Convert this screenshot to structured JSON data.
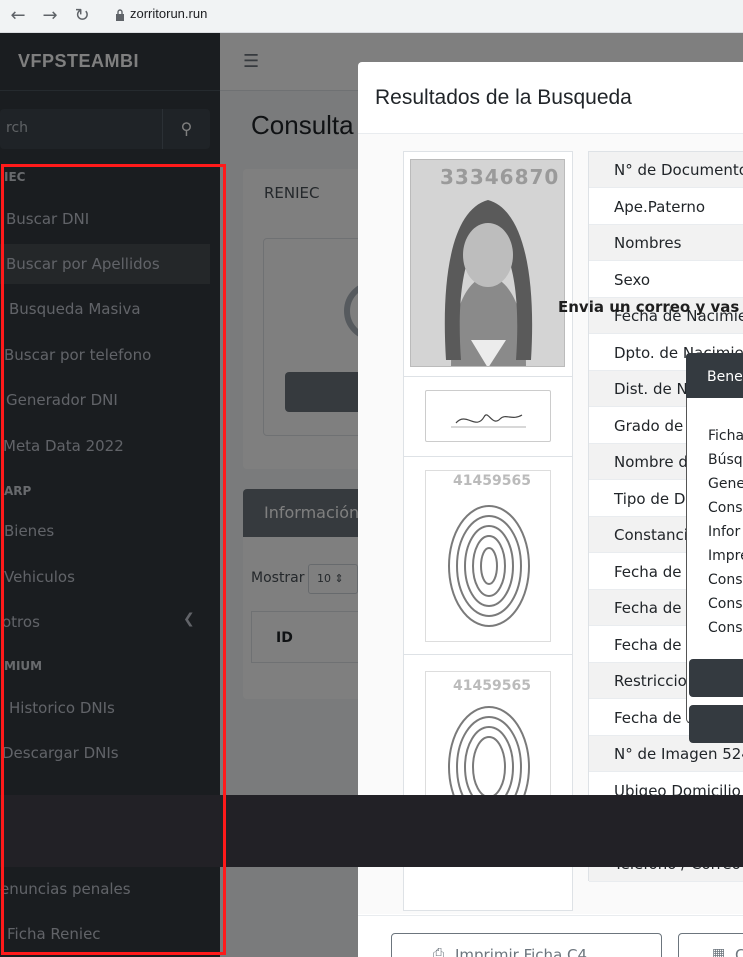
{
  "browser": {
    "url": "zorritorun.run",
    "back_icon": "arrow-left-icon",
    "forward_icon": "arrow-right-icon",
    "reload_icon": "reload-icon"
  },
  "sidebar": {
    "brand": "VFPSTEAMBI",
    "search_placeholder": "rch",
    "sections": [
      {
        "header": "IEC"
      },
      {
        "header": "ARP"
      },
      {
        "header": "MIUM"
      }
    ],
    "items": [
      {
        "label": "Buscar DNI"
      },
      {
        "label": "Buscar por Apellidos"
      },
      {
        "label": "Busqueda Masiva"
      },
      {
        "label": "Buscar por telefono"
      },
      {
        "label": "Generador DNI"
      },
      {
        "label": "Meta Data 2022"
      },
      {
        "label": "Bienes"
      },
      {
        "label": "Vehiculos"
      },
      {
        "label": "otros"
      },
      {
        "label": "Historico DNIs"
      },
      {
        "label": "Descargar DNIs"
      },
      {
        "label": "enuncias penales"
      },
      {
        "label": "Ficha Reniec"
      }
    ]
  },
  "content": {
    "title": "Consulta",
    "reniec_card_title": "RENIEC",
    "info_card_title": "Información",
    "mostrar_label": "Mostrar",
    "mostrar_value": "10",
    "table_header_id": "ID"
  },
  "modal": {
    "title": "Resultados de la Busqueda",
    "photo_number": "33346870",
    "finger_numbers": [
      "41459565",
      "41459565"
    ],
    "fields": [
      "N° de Documento",
      "Ape.Paterno",
      "Nombres",
      "Sexo",
      "Fecha de Nacimiento",
      "Dpto. de Nacimiento",
      "Dist. de Na",
      "Grado de I",
      "Nombre d",
      "Tipo de Do",
      "Constancia",
      "Fecha de I",
      "Fecha de E",
      "Fecha de C",
      "Restriccio",
      "Fecha de F",
      "N° de Imagen 5248",
      "Ubigeo Domicilio",
      "Telefono / Correo"
    ],
    "print_button": "Imprimir Ficha C4",
    "second_button": "C"
  },
  "promo": {
    "text": "Envia un correo y vas a p",
    "card_title": "Benef",
    "items": [
      "Ficha",
      "Búsq",
      "Gene",
      "Cons",
      "Infor",
      "Impre",
      "Cons",
      "Cons",
      "Cons"
    ]
  }
}
